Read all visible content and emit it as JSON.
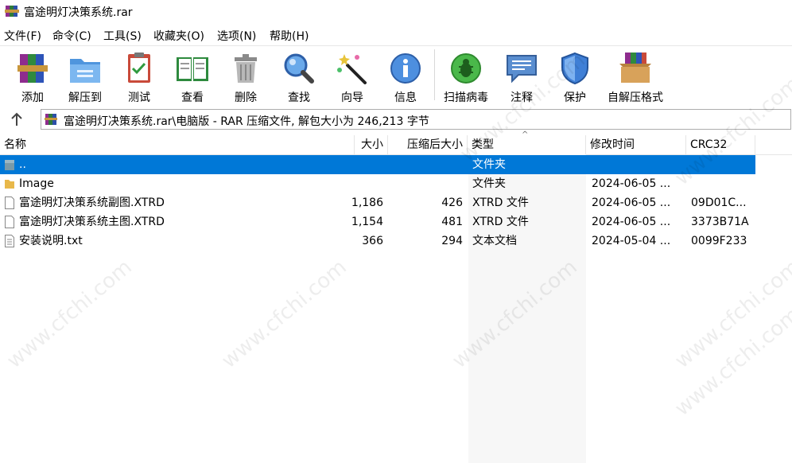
{
  "window": {
    "title": "富途明灯决策系统.rar"
  },
  "menu": [
    "文件(F)",
    "命令(C)",
    "工具(S)",
    "收藏夹(O)",
    "选项(N)",
    "帮助(H)"
  ],
  "toolbar": [
    {
      "label": "添加",
      "icon": "books-add-icon"
    },
    {
      "label": "解压到",
      "icon": "folder-extract-icon"
    },
    {
      "label": "测试",
      "icon": "clipboard-check-icon"
    },
    {
      "label": "查看",
      "icon": "open-book-icon"
    },
    {
      "label": "删除",
      "icon": "trash-can-icon"
    },
    {
      "label": "查找",
      "icon": "magnifier-icon"
    },
    {
      "label": "向导",
      "icon": "magic-wand-icon"
    },
    {
      "label": "信息",
      "icon": "info-icon"
    },
    {
      "label": "扫描病毒",
      "icon": "bug-scan-icon"
    },
    {
      "label": "注释",
      "icon": "comment-icon"
    },
    {
      "label": "保护",
      "icon": "shield-icon"
    },
    {
      "label": "自解压格式",
      "icon": "sfx-box-icon"
    }
  ],
  "address": {
    "path": "富途明灯决策系统.rar\\电脑版 - RAR 压缩文件, 解包大小为 246,213 字节"
  },
  "columns": [
    "名称",
    "大小",
    "压缩后大小",
    "类型",
    "修改时间",
    "CRC32"
  ],
  "files": [
    {
      "name": "..",
      "size": "",
      "packed": "",
      "type": "文件夹",
      "modified": "",
      "crc": "",
      "kind": "parent",
      "selected": true
    },
    {
      "name": "Image",
      "size": "",
      "packed": "",
      "type": "文件夹",
      "modified": "2024-06-05 ...",
      "crc": "",
      "kind": "folder",
      "selected": false
    },
    {
      "name": "富途明灯决策系统副图.XTRD",
      "size": "1,186",
      "packed": "426",
      "type": "XTRD 文件",
      "modified": "2024-06-05 ...",
      "crc": "09D01C...",
      "kind": "file",
      "selected": false
    },
    {
      "name": "富途明灯决策系统主图.XTRD",
      "size": "1,154",
      "packed": "481",
      "type": "XTRD 文件",
      "modified": "2024-06-05 ...",
      "crc": "3373B71A",
      "kind": "file",
      "selected": false
    },
    {
      "name": "安装说明.txt",
      "size": "366",
      "packed": "294",
      "type": "文本文档",
      "modified": "2024-05-04 ...",
      "crc": "0099F233",
      "kind": "text",
      "selected": false
    }
  ],
  "watermark": "www.cfchi.com",
  "colors": {
    "selection": "#0078d7",
    "folder": "#e8b84a"
  }
}
